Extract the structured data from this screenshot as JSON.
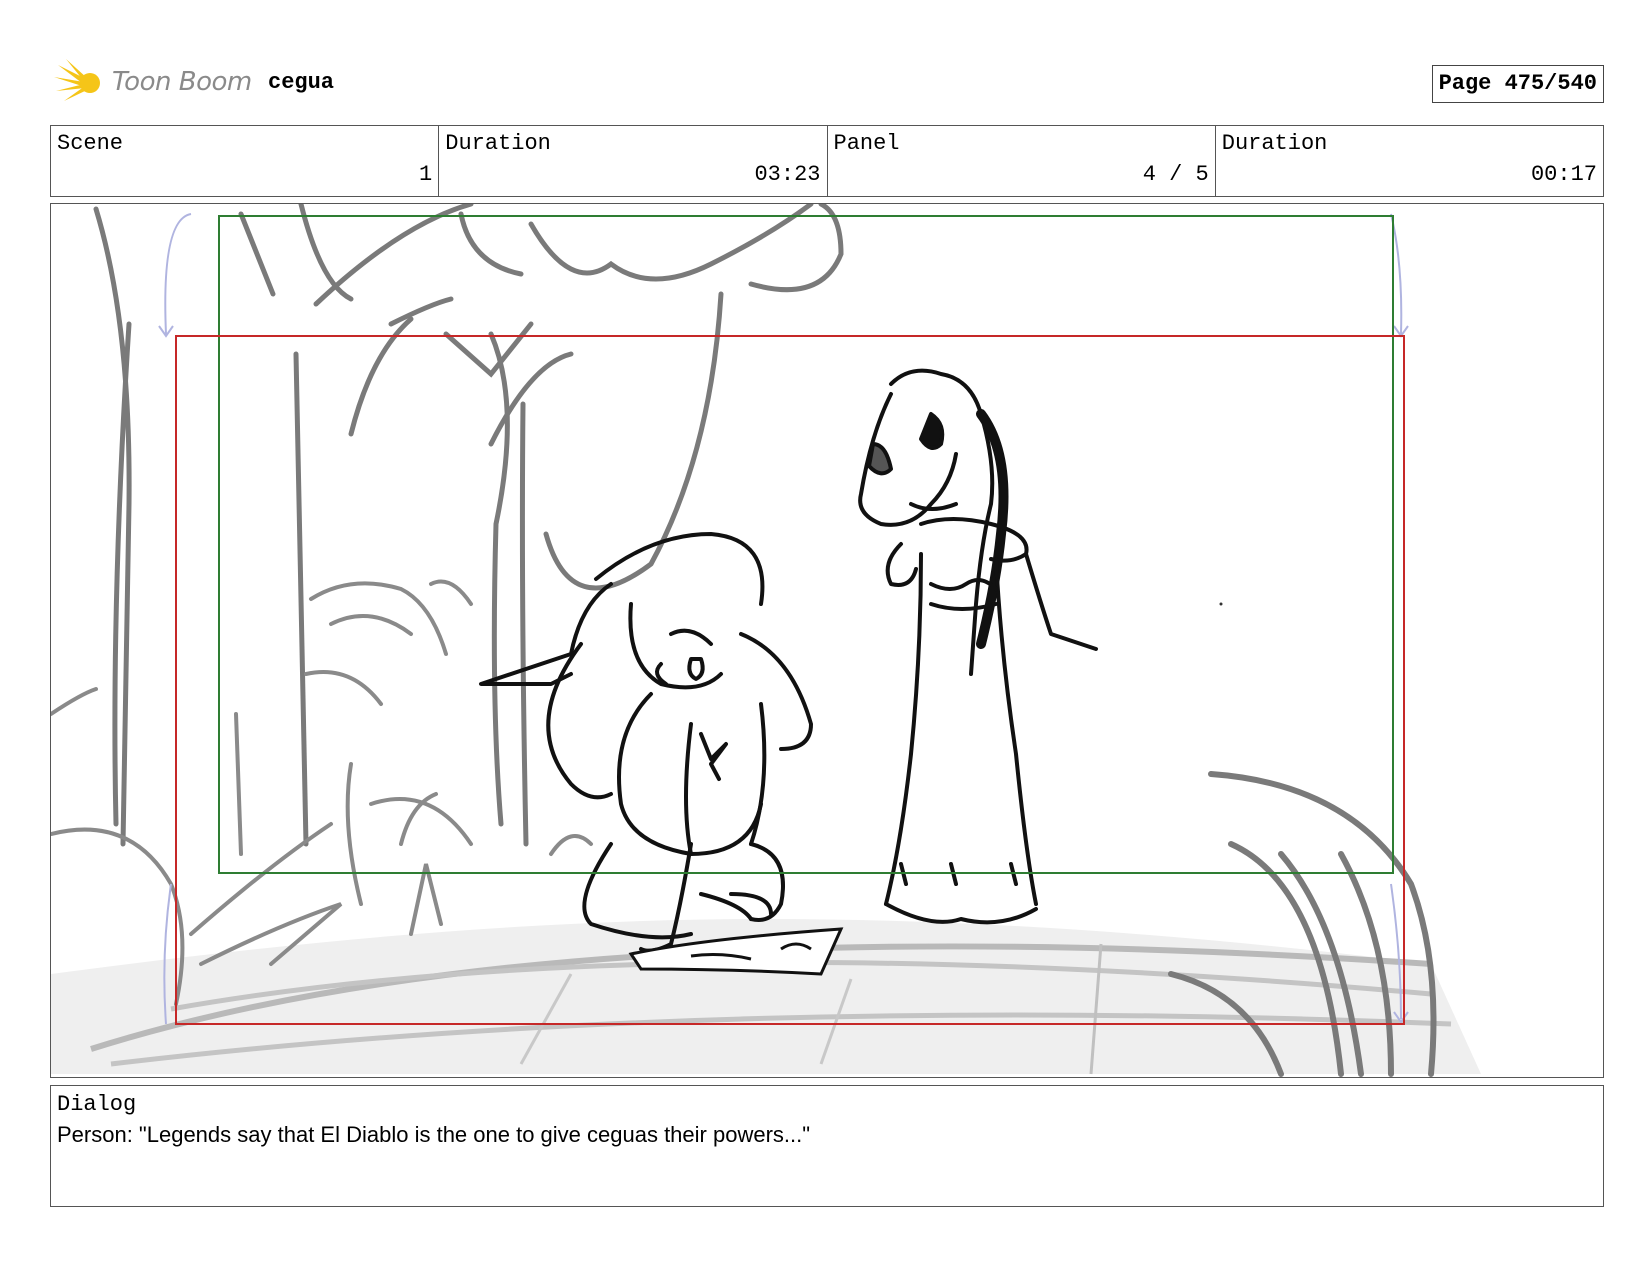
{
  "header": {
    "logo_text": "Toon Boom",
    "project_title": "cegua",
    "page_label": "Page 475/540"
  },
  "info": {
    "scene_label": "Scene",
    "scene_value": "1",
    "scene_duration_label": "Duration",
    "scene_duration_value": "03:23",
    "panel_label": "Panel",
    "panel_value": "4 / 5",
    "panel_duration_label": "Duration",
    "panel_duration_value": "00:17"
  },
  "dialog": {
    "label": "Dialog",
    "text": "Person: \"Legends say that El Diablo is the one to give ceguas their powers...\""
  },
  "colors": {
    "safe_frame": "#2e7d32",
    "camera_frame": "#c62828",
    "guide_arrow": "#b0b4e0",
    "sketch_gray": "#777777"
  }
}
